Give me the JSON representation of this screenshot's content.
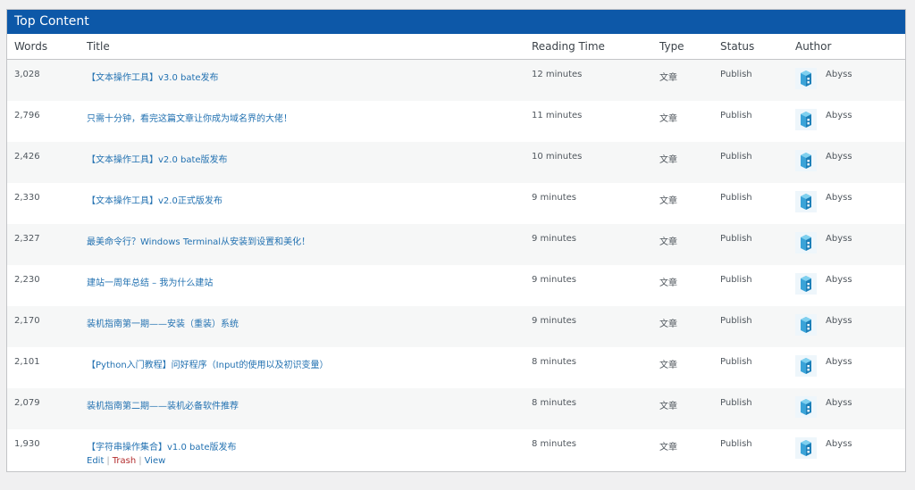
{
  "panel": {
    "title": "Top Content"
  },
  "columns": {
    "words": "Words",
    "title": "Title",
    "reading_time": "Reading Time",
    "type": "Type",
    "status": "Status",
    "author": "Author"
  },
  "rows": [
    {
      "words": "3,028",
      "title": "【文本操作工具】v3.0 bate发布",
      "reading_time": "12 minutes",
      "type": "文章",
      "status": "Publish",
      "author": "Abyss"
    },
    {
      "words": "2,796",
      "title": "只需十分钟，看完这篇文章让你成为域名界的大佬！",
      "reading_time": "11 minutes",
      "type": "文章",
      "status": "Publish",
      "author": "Abyss"
    },
    {
      "words": "2,426",
      "title": "【文本操作工具】v2.0 bate版发布",
      "reading_time": "10 minutes",
      "type": "文章",
      "status": "Publish",
      "author": "Abyss"
    },
    {
      "words": "2,330",
      "title": "【文本操作工具】v2.0正式版发布",
      "reading_time": "9 minutes",
      "type": "文章",
      "status": "Publish",
      "author": "Abyss"
    },
    {
      "words": "2,327",
      "title": "最美命令行？Windows Terminal从安装到设置和美化！",
      "reading_time": "9 minutes",
      "type": "文章",
      "status": "Publish",
      "author": "Abyss"
    },
    {
      "words": "2,230",
      "title": "建站一周年总结 – 我为什么建站",
      "reading_time": "9 minutes",
      "type": "文章",
      "status": "Publish",
      "author": "Abyss"
    },
    {
      "words": "2,170",
      "title": "装机指南第一期——安装（重装）系统",
      "reading_time": "9 minutes",
      "type": "文章",
      "status": "Publish",
      "author": "Abyss"
    },
    {
      "words": "2,101",
      "title": "【Python入门教程】问好程序（Input的使用以及初识变量）",
      "reading_time": "8 minutes",
      "type": "文章",
      "status": "Publish",
      "author": "Abyss"
    },
    {
      "words": "2,079",
      "title": "装机指南第二期——装机必备软件推荐",
      "reading_time": "8 minutes",
      "type": "文章",
      "status": "Publish",
      "author": "Abyss"
    },
    {
      "words": "1,930",
      "title": "【字符串操作集合】v1.0 bate版发布",
      "reading_time": "8 minutes",
      "type": "文章",
      "status": "Publish",
      "author": "Abyss"
    }
  ],
  "row_actions": {
    "edit": "Edit",
    "trash": "Trash",
    "view": "View",
    "separator": "|"
  },
  "icons": {
    "avatar": "avatar-icon"
  },
  "colors": {
    "header_bg": "#0d58a8",
    "link": "#2271b1",
    "trash": "#b32d2e"
  }
}
